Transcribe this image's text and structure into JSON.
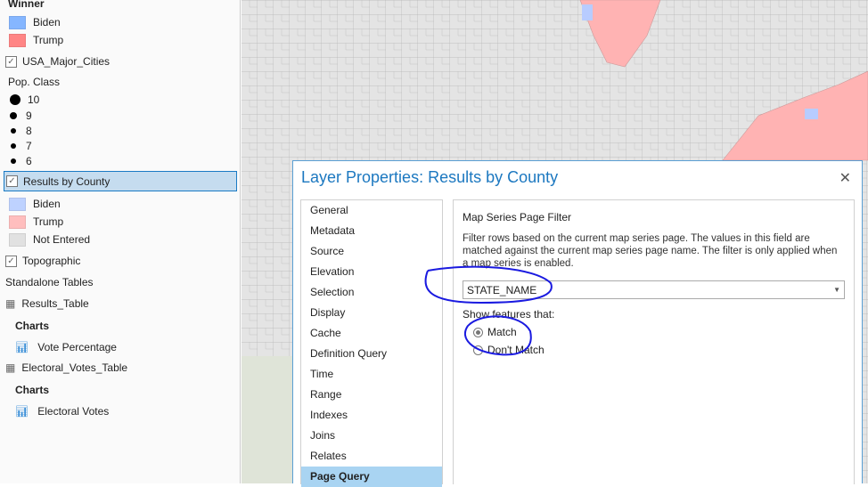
{
  "toc": {
    "winner_heading": "Winner",
    "winner_legend": [
      {
        "label": "Biden",
        "color": "#85b6ff"
      },
      {
        "label": "Trump",
        "color": "#ff8585"
      }
    ],
    "cities_layer": "USA_Major_Cities",
    "pop_heading": "Pop. Class",
    "pop_classes": [
      "10",
      "9",
      "8",
      "7",
      "6"
    ],
    "county_layer": "Results by County",
    "county_legend": [
      {
        "label": "Biden",
        "color": "#bed2ff"
      },
      {
        "label": "Trump",
        "color": "#ffbebe"
      },
      {
        "label": "Not Entered",
        "color": "#e1e1e1"
      }
    ],
    "topo_layer": "Topographic",
    "standalone_heading": "Standalone Tables",
    "tables": [
      {
        "name": "Results_Table",
        "charts_label": "Charts",
        "chart": "Vote Percentage"
      },
      {
        "name": "Electoral_Votes_Table",
        "charts_label": "Charts",
        "chart": "Electoral Votes"
      }
    ]
  },
  "dialog": {
    "title": "Layer Properties: Results by County",
    "nav": [
      "General",
      "Metadata",
      "Source",
      "Elevation",
      "Selection",
      "Display",
      "Cache",
      "Definition Query",
      "Time",
      "Range",
      "Indexes",
      "Joins",
      "Relates",
      "Page Query"
    ],
    "selected_nav": "Page Query",
    "section_title": "Map Series Page Filter",
    "description": "Filter rows based on the current map series page. The values in this field are matched against the current map series page name. The filter is only applied when a map series is enabled.",
    "field_value": "STATE_NAME",
    "show_label": "Show features that:",
    "options": [
      "Match",
      "Don't Match"
    ],
    "selected_option": "Match"
  }
}
